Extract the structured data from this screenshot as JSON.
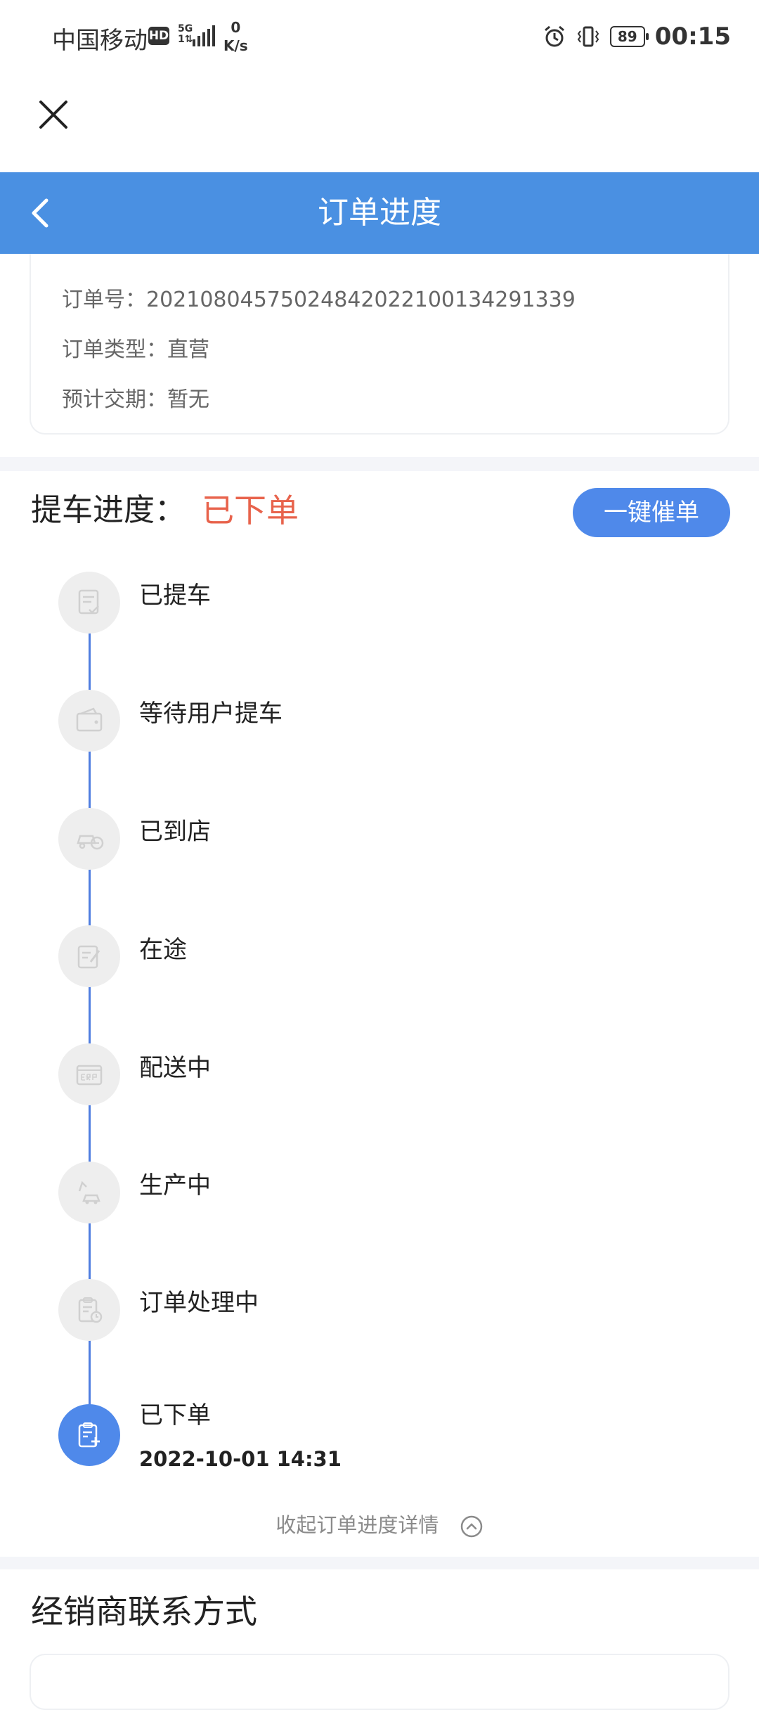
{
  "status_bar": {
    "carrier": "中国移动",
    "hd": "HD",
    "network": "5G",
    "network_sub": "1⇅",
    "speed_value": "0",
    "speed_unit": "K/s",
    "battery": "89",
    "time": "00:15"
  },
  "nav": {
    "title": "订单进度"
  },
  "order": {
    "number": "订单号：20210804575024842022100134291339",
    "type": "订单类型：直营",
    "delivery": "预计交期：暂无"
  },
  "progress": {
    "header": "提车进度：",
    "status": "已下单",
    "urge_button": "一键催单",
    "steps": [
      {
        "label": "已提车",
        "icon": "document-check-icon",
        "active": false
      },
      {
        "label": "等待用户提车",
        "icon": "wallet-icon",
        "active": false
      },
      {
        "label": "已到店",
        "icon": "car-shop-icon",
        "active": false
      },
      {
        "label": "在途",
        "icon": "edit-note-icon",
        "active": false
      },
      {
        "label": "配送中",
        "icon": "erp-box-icon",
        "active": false
      },
      {
        "label": "生产中",
        "icon": "factory-car-icon",
        "active": false
      },
      {
        "label": "订单处理中",
        "icon": "clipboard-clock-icon",
        "active": false
      },
      {
        "label": "已下单",
        "icon": "clipboard-add-icon",
        "active": true,
        "time": "2022-10-01 14:31"
      }
    ],
    "collapse_label": "收起订单进度详情"
  },
  "dealer": {
    "title": "经销商联系方式"
  },
  "colors": {
    "primary": "#4a90e2",
    "button": "#4f89ea",
    "status": "#e8634c",
    "line": "#4f7de0"
  }
}
